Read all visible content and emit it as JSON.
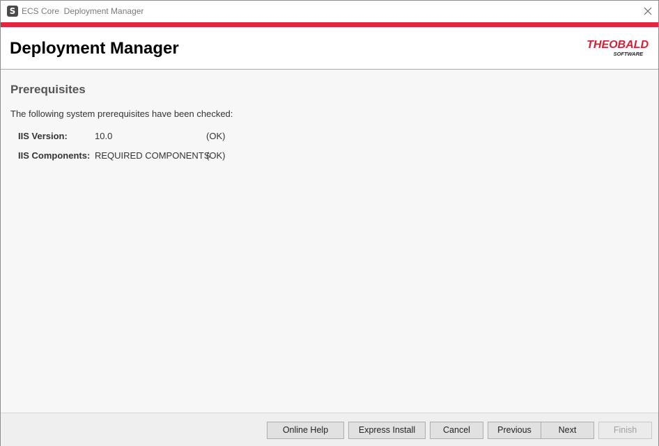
{
  "window": {
    "title": "ECS Core  Deployment Manager",
    "app_icon_glyph": "S",
    "accent_color": "#e3253f"
  },
  "header": {
    "title": "Deployment Manager",
    "logo": {
      "brand": "THEOBALD",
      "sub": "SOFTWARE"
    }
  },
  "content": {
    "section_title": "Prerequisites",
    "intro": "The following system prerequisites have been checked:",
    "checks": [
      {
        "label": "IIS Version:",
        "value": "10.0",
        "status": "(OK)"
      },
      {
        "label": "IIS Components:",
        "value": "REQUIRED COMPONENTS",
        "status": "(OK)"
      }
    ]
  },
  "footer": {
    "buttons": {
      "online_help": "Online Help",
      "express_install": "Express Install",
      "cancel": "Cancel",
      "previous": "Previous",
      "next": "Next",
      "finish": "Finish"
    }
  }
}
